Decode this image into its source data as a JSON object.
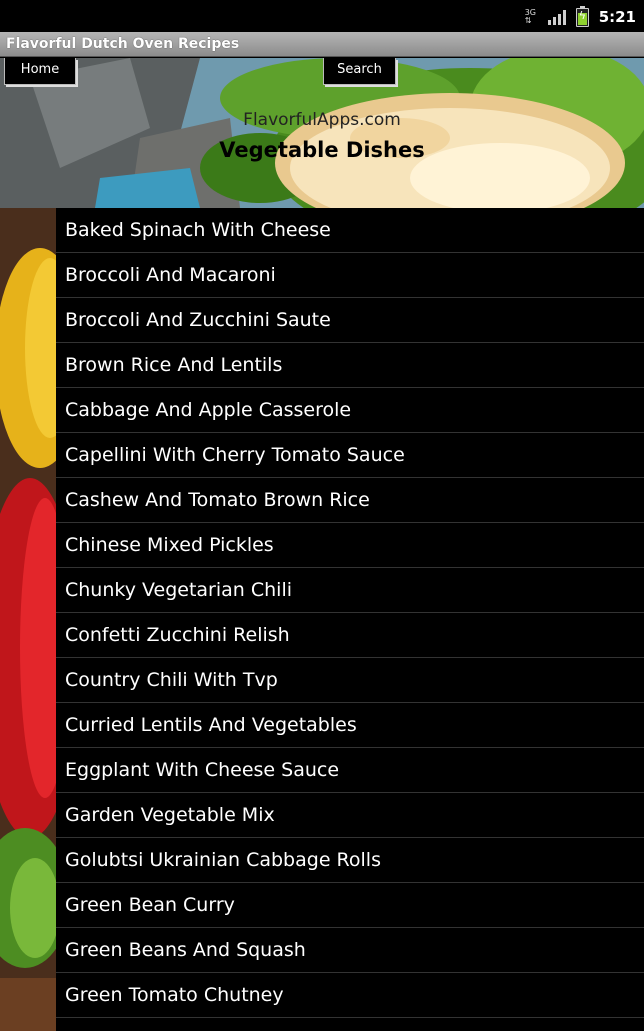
{
  "status_bar": {
    "time": "5:21",
    "icons": [
      "data-network-icon",
      "signal-strength-icon",
      "battery-charging-icon"
    ],
    "network_label": "3G"
  },
  "app": {
    "title": "Flavorful Dutch Oven Recipes"
  },
  "header": {
    "home_label": "Home",
    "search_label": "Search",
    "site_label": "FlavorfulApps.com",
    "section_title": "Vegetable Dishes"
  },
  "recipes": [
    "Baked Spinach With Cheese",
    "Broccoli And Macaroni",
    "Broccoli And Zucchini Saute",
    "Brown Rice And Lentils",
    "Cabbage And Apple Casserole",
    "Capellini With Cherry Tomato Sauce",
    "Cashew And Tomato Brown Rice",
    "Chinese Mixed Pickles",
    "Chunky Vegetarian Chili",
    "Confetti Zucchini Relish",
    "Country Chili With Tvp",
    "Curried Lentils And Vegetables",
    "Eggplant With Cheese Sauce",
    "Garden Vegetable Mix",
    "Golubtsi Ukrainian Cabbage Rolls",
    "Green Bean Curry",
    "Green Beans And Squash",
    "Green Tomato Chutney"
  ],
  "colors": {
    "list_background": "#000000",
    "list_text": "#ffffff",
    "divider": "#333333",
    "titlebar": "#9e9e9e"
  }
}
